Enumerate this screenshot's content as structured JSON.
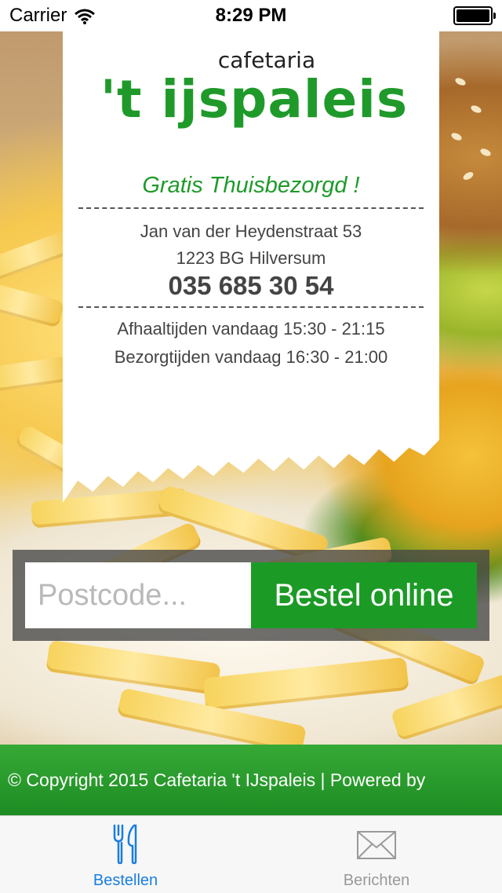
{
  "status": {
    "carrier": "Carrier",
    "time": "8:29 PM"
  },
  "brand": {
    "small": "cafetaria",
    "big": "'t ijspaleis"
  },
  "tagline": "Gratis Thuisbezorgd !",
  "address": {
    "street": "Jan van der Heydenstraat 53",
    "city": "1223 BG Hilversum",
    "phone": "035 685 30 54"
  },
  "hours": {
    "pickup": "Afhaaltijden vandaag 15:30 - 21:15",
    "delivery": "Bezorgtijden vandaag 16:30 - 21:00"
  },
  "order": {
    "postcode_placeholder": "Postcode...",
    "button_label": "Bestel online"
  },
  "footer": {
    "copyright": "© Copyright 2015 Cafetaria 't IJspaleis | Powered by"
  },
  "tabs": [
    {
      "label": "Bestellen",
      "icon": "fork-knife-icon",
      "active": true
    },
    {
      "label": "Berichten",
      "icon": "envelope-icon",
      "active": false
    }
  ],
  "colors": {
    "brand_green": "#1f9a2a",
    "tab_active": "#1a7de0",
    "tab_inactive": "#999999"
  }
}
